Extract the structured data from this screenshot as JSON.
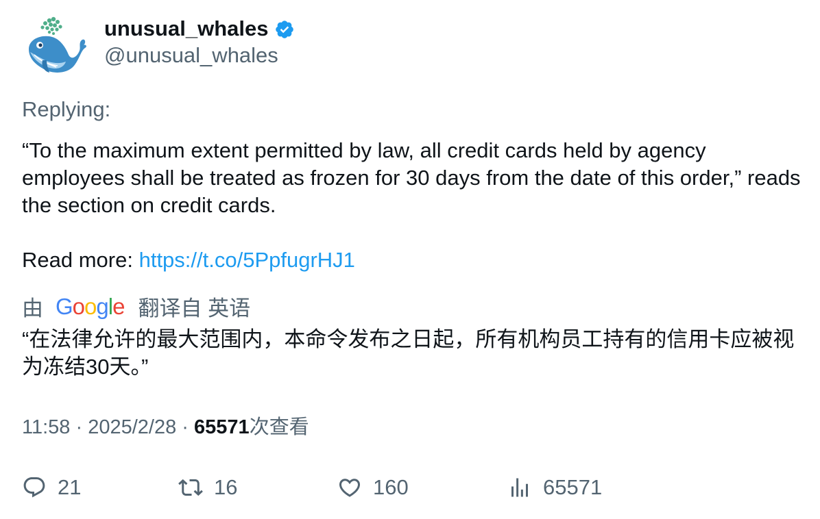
{
  "author": {
    "display_name": "unusual_whales",
    "handle": "@unusual_whales",
    "avatar_icon": "whale-logo-icon",
    "verified_icon": "verified-badge-icon",
    "verified_color": "#1d9bf0"
  },
  "tweet": {
    "replying_label": "Replying:",
    "body": "“To the maximum extent permitted by law, all credit cards held by agency employees shall be treated as frozen for 30 days from the date of this order,” reads the section on credit cards.",
    "readmore_label": "Read more:",
    "link_text": "https://t.co/5PpfugrHJ1",
    "link_color": "#1d9bf0"
  },
  "translation": {
    "prefix": "由",
    "provider": "Google",
    "suffix": "翻译自 英语",
    "text": "“在法律允许的最大范围内，本命令发布之日起，所有机构员工持有的信用卡应被视为冻结30天。”"
  },
  "meta": {
    "time": "11:58",
    "sep1": "·",
    "date": "2025/2/28",
    "sep2": "·",
    "views": "65571",
    "views_suffix": "次查看"
  },
  "actions": {
    "reply_count": "21",
    "retweet_count": "16",
    "like_count": "160",
    "views_count": "65571"
  }
}
